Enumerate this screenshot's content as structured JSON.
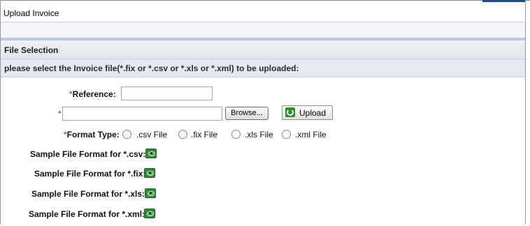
{
  "window": {
    "title": "Upload Invoice"
  },
  "section": {
    "title": "File Selection",
    "instruction": "please select the Invoice file(*.fix or *.csv or *.xls or *.xml) to be uploaded:"
  },
  "form": {
    "required_marker": "*",
    "reference_label": "Reference:",
    "reference_value": "",
    "file_path_value": "",
    "browse_label": "Browse...",
    "upload_label": "Upload",
    "format_type_label": "Format Type:",
    "format_options": [
      ".csv File",
      ".fix File",
      ".xls File",
      ".xml File"
    ],
    "format_selected": null
  },
  "samples": [
    {
      "label": "Sample File Format for *.csv:",
      "icon": "view-sample-icon"
    },
    {
      "label": "Sample File Format for *.fix:",
      "icon": "view-sample-icon"
    },
    {
      "label": "Sample File Format for *.xls:",
      "icon": "view-sample-icon"
    },
    {
      "label": "Sample File Format for *.xml:",
      "icon": "view-sample-icon"
    }
  ],
  "colors": {
    "required": "#d40000",
    "section_header_bg": "#e2e7ee",
    "instruction_bg": "#e5eaf2",
    "accent_stripe": "#b7c8df",
    "icon_green": "#2f8a3a"
  }
}
